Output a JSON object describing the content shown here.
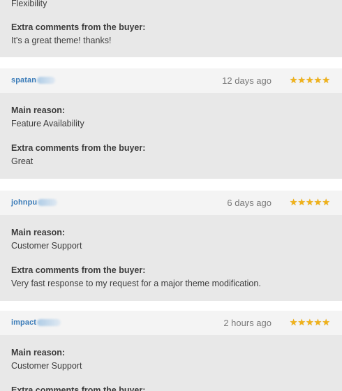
{
  "reviews": [
    {
      "main_reason_value": "Flexibility",
      "comments_label": "Extra comments from the buyer:",
      "comments": "It's a great theme! thanks!"
    },
    {
      "username": "spatan",
      "time": "12 days ago",
      "stars": "★★★★★",
      "rating": 5,
      "main_reason_label": "Main reason:",
      "main_reason_value": "Feature Availability",
      "comments_label": "Extra comments from the buyer:",
      "comments": "Great"
    },
    {
      "username": "johnpu",
      "time": "6 days ago",
      "stars": "★★★★★",
      "rating": 5,
      "main_reason_label": "Main reason:",
      "main_reason_value": "Customer Support",
      "comments_label": "Extra comments from the buyer:",
      "comments": "Very fast response to my request for a major theme modification."
    },
    {
      "username": "impact",
      "time": "2 hours ago",
      "stars": "★★★★★",
      "rating": 5,
      "main_reason_label": "Main reason:",
      "main_reason_value": "Customer Support",
      "comments_label": "Extra comments from the buyer:"
    }
  ]
}
